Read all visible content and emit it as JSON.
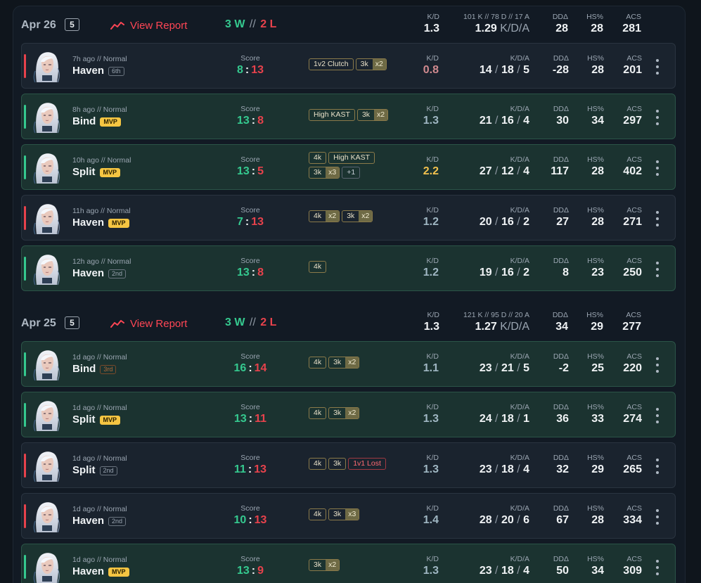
{
  "colors": {
    "win": "#35c98f",
    "loss": "#e7424c",
    "kd_gold": "#f2c14e",
    "kd_bad": "#d08a8f",
    "kd_default": "#9fb6c2"
  },
  "stat_labels": {
    "kd": "K/D",
    "kda": "K/D/A",
    "dd": "DDΔ",
    "hs": "HS%",
    "acs": "ACS",
    "score": "Score"
  },
  "days": [
    {
      "date": "Apr 26",
      "count": "5",
      "report": "View Report",
      "icon": "trend-line-icon",
      "wins": "3 W",
      "wl_sep": "//",
      "losses": "2 L",
      "summary": {
        "kd": "1.3",
        "kda_label": "101 K // 78 D // 17 A",
        "kda_value": "1.29",
        "kda_unit": "K/D/A",
        "dd": "28",
        "hs": "28",
        "acs": "281"
      },
      "matches": [
        {
          "result": "loss",
          "ago": "7h ago // Normal",
          "map": "Haven",
          "placement": "6th",
          "placement_style": "plain",
          "us": "8",
          "them": "13",
          "badges": [
            [
              {
                "t": "1v2 Clutch"
              },
              {
                "t": "3k",
                "m": "x2"
              }
            ]
          ],
          "kd": "0.8",
          "kd_color": "kd_bad",
          "k": "14",
          "d": "18",
          "a": "5",
          "dd": "-28",
          "hs": "28",
          "acs": "201"
        },
        {
          "result": "win",
          "ago": "8h ago // Normal",
          "map": "Bind",
          "placement": "MVP",
          "placement_style": "mvp",
          "us": "13",
          "them": "8",
          "badges": [
            [
              {
                "t": "High KAST"
              },
              {
                "t": "3k",
                "m": "x2"
              }
            ]
          ],
          "kd": "1.3",
          "kd_color": "kd_default",
          "k": "21",
          "d": "16",
          "a": "4",
          "dd": "30",
          "hs": "34",
          "acs": "297"
        },
        {
          "result": "win",
          "ago": "10h ago // Normal",
          "map": "Split",
          "placement": "MVP",
          "placement_style": "mvp",
          "us": "13",
          "them": "5",
          "badges": [
            [
              {
                "t": "4k"
              },
              {
                "t": "High KAST"
              }
            ],
            [
              {
                "t": "3k",
                "m": "x3"
              },
              {
                "t": "+1",
                "style": "plain"
              }
            ]
          ],
          "kd": "2.2",
          "kd_color": "kd_gold",
          "k": "27",
          "d": "12",
          "a": "4",
          "dd": "117",
          "hs": "28",
          "acs": "402"
        },
        {
          "result": "loss",
          "ago": "11h ago // Normal",
          "map": "Haven",
          "placement": "MVP",
          "placement_style": "mvp",
          "us": "7",
          "them": "13",
          "badges": [
            [
              {
                "t": "4k",
                "m": "x2"
              },
              {
                "t": "3k",
                "m": "x2"
              }
            ]
          ],
          "kd": "1.2",
          "kd_color": "kd_default",
          "k": "20",
          "d": "16",
          "a": "2",
          "dd": "27",
          "hs": "28",
          "acs": "271"
        },
        {
          "result": "win",
          "ago": "12h ago // Normal",
          "map": "Haven",
          "placement": "2nd",
          "placement_style": "plain",
          "us": "13",
          "them": "8",
          "badges": [
            [
              {
                "t": "4k"
              }
            ]
          ],
          "kd": "1.2",
          "kd_color": "kd_default",
          "k": "19",
          "d": "16",
          "a": "2",
          "dd": "8",
          "hs": "23",
          "acs": "250"
        }
      ]
    },
    {
      "date": "Apr 25",
      "count": "5",
      "report": "View Report",
      "icon": "trend-line-icon",
      "wins": "3 W",
      "wl_sep": "//",
      "losses": "2 L",
      "summary": {
        "kd": "1.3",
        "kda_label": "121 K // 95 D // 20 A",
        "kda_value": "1.27",
        "kda_unit": "K/D/A",
        "dd": "34",
        "hs": "29",
        "acs": "277"
      },
      "matches": [
        {
          "result": "win",
          "ago": "1d ago // Normal",
          "map": "Bind",
          "placement": "3rd",
          "placement_style": "bronze",
          "us": "16",
          "them": "14",
          "badges": [
            [
              {
                "t": "4k"
              },
              {
                "t": "3k",
                "m": "x2"
              }
            ]
          ],
          "kd": "1.1",
          "kd_color": "kd_default",
          "k": "23",
          "d": "21",
          "a": "5",
          "dd": "-2",
          "hs": "25",
          "acs": "220"
        },
        {
          "result": "win",
          "ago": "1d ago // Normal",
          "map": "Split",
          "placement": "MVP",
          "placement_style": "mvp",
          "us": "13",
          "them": "11",
          "badges": [
            [
              {
                "t": "4k"
              },
              {
                "t": "3k",
                "m": "x2"
              }
            ]
          ],
          "kd": "1.3",
          "kd_color": "kd_default",
          "k": "24",
          "d": "18",
          "a": "1",
          "dd": "36",
          "hs": "33",
          "acs": "274"
        },
        {
          "result": "loss",
          "ago": "1d ago // Normal",
          "map": "Split",
          "placement": "2nd",
          "placement_style": "plain",
          "us": "11",
          "them": "13",
          "badges": [
            [
              {
                "t": "4k"
              },
              {
                "t": "3k"
              },
              {
                "t": "1v1 Lost",
                "style": "lost"
              }
            ]
          ],
          "kd": "1.3",
          "kd_color": "kd_default",
          "k": "23",
          "d": "18",
          "a": "4",
          "dd": "32",
          "hs": "29",
          "acs": "265"
        },
        {
          "result": "loss",
          "ago": "1d ago // Normal",
          "map": "Haven",
          "placement": "2nd",
          "placement_style": "plain",
          "us": "10",
          "them": "13",
          "badges": [
            [
              {
                "t": "4k"
              },
              {
                "t": "3k",
                "m": "x3"
              }
            ]
          ],
          "kd": "1.4",
          "kd_color": "kd_default",
          "k": "28",
          "d": "20",
          "a": "6",
          "dd": "67",
          "hs": "28",
          "acs": "334"
        },
        {
          "result": "win",
          "ago": "1d ago // Normal",
          "map": "Haven",
          "placement": "MVP",
          "placement_style": "mvp",
          "us": "13",
          "them": "9",
          "badges": [
            [
              {
                "t": "3k",
                "m": "x2"
              }
            ]
          ],
          "kd": "1.3",
          "kd_color": "kd_default",
          "k": "23",
          "d": "18",
          "a": "4",
          "dd": "50",
          "hs": "34",
          "acs": "309"
        }
      ]
    }
  ]
}
